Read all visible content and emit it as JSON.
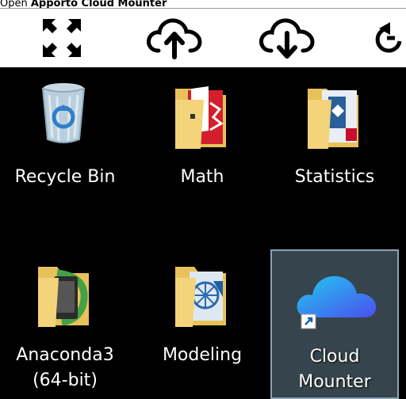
{
  "instruction": {
    "prefix": "Open ",
    "target": "Apporto Cloud Mounter"
  },
  "toolbar": {
    "buttons": [
      {
        "icon": "fullscreen-icon"
      },
      {
        "icon": "cloud-upload-icon"
      },
      {
        "icon": "cloud-download-icon"
      },
      {
        "icon": "refresh-icon"
      }
    ]
  },
  "desktop": {
    "icons": [
      {
        "line1": "Recycle Bin",
        "line2": ""
      },
      {
        "line1": "Math",
        "line2": ""
      },
      {
        "line1": "Statistics",
        "line2": ""
      },
      {
        "line1": "Anaconda3",
        "line2": "(64-bit)"
      },
      {
        "line1": "Modeling",
        "line2": ""
      },
      {
        "line1": "Cloud",
        "line2": "Mounter"
      }
    ]
  }
}
